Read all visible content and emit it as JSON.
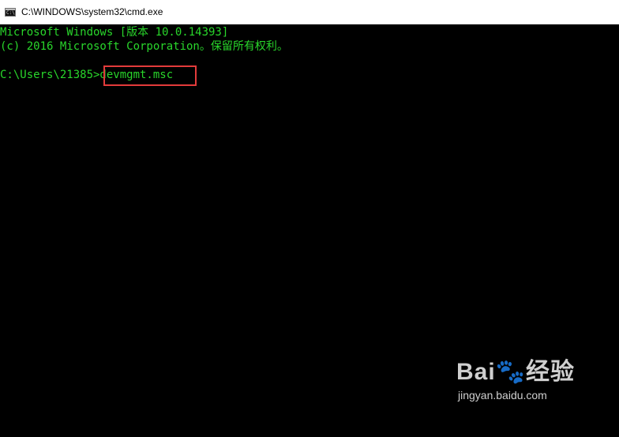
{
  "window": {
    "title": "C:\\WINDOWS\\system32\\cmd.exe",
    "icon": "cmd-icon"
  },
  "console": {
    "lines": [
      "Microsoft Windows [版本 10.0.14393]",
      "(c) 2016 Microsoft Corporation。保留所有权利。",
      "C:\\Users\\21385>devmgmt.msc"
    ],
    "prompt": "C:\\Users\\21385>",
    "command": "devmgmt.msc",
    "text_color": "#29d62b",
    "background_color": "#000000",
    "highlight_color": "#e33b3b"
  },
  "watermark": {
    "logo": "Bai🐾经验",
    "url": "jingyan.baidu.com"
  }
}
